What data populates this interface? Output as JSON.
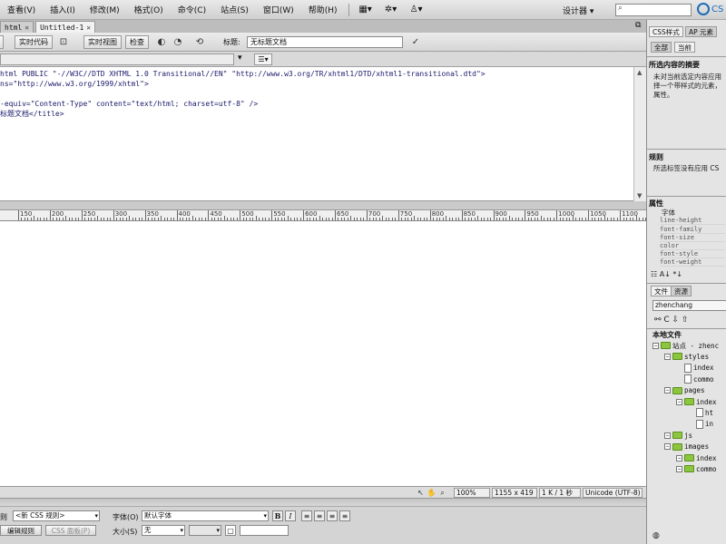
{
  "menubar": {
    "items": [
      "查看(V)",
      "插入(I)",
      "修改(M)",
      "格式(O)",
      "命令(C)",
      "站点(S)",
      "窗口(W)",
      "帮助(H)"
    ],
    "workspace": "设计器 ▾",
    "logo": "CS"
  },
  "doctabs": [
    {
      "label": "html",
      "active": false
    },
    {
      "label": "Untitled-1",
      "active": true
    }
  ],
  "doctoolbar": {
    "live_code": "实时代码",
    "live_view": "实时视图",
    "inspect": "检查",
    "title_label": "标题:",
    "title_value": "无标题文档"
  },
  "code_lines": [
    "html PUBLIC \"-//W3C//DTD XHTML 1.0 Transitional//EN\" \"http://www.w3.org/TR/xhtml1/DTD/xhtml1-transitional.dtd\">",
    "ns=\"http://www.w3.org/1999/xhtml\">",
    "",
    "-equiv=\"Content-Type\" content=\"text/html; charset=utf-8\" />",
    "标题文档</title>"
  ],
  "ruler_labels": [
    "150",
    "200",
    "250",
    "300",
    "350",
    "400",
    "450",
    "500",
    "550",
    "600",
    "650",
    "700",
    "750",
    "800",
    "850",
    "900",
    "950",
    "1000",
    "1050",
    "1100"
  ],
  "statusbar": {
    "zoom": "100%",
    "size": "1155 x 419",
    "filesize": "1 K / 1 秒",
    "encoding": "Unicode (UTF-8)"
  },
  "props": {
    "rule_label": "则",
    "rule_value": "<新 CSS 规则>",
    "edit_rule": "编辑规则",
    "css_panel": "CSS 面板(P)",
    "font_label": "字体(O)",
    "font_value": "默认字体",
    "size_label": "大小(S)",
    "size_value": "无",
    "bold": "B",
    "italic": "I"
  },
  "rpanel": {
    "tab_css": "CSS样式",
    "tab_ap": "AP 元素",
    "sub_all": "全部",
    "sub_current": "当前",
    "summary_header": "所选内容的摘要",
    "summary_lines": [
      "未对当前选定内容应用",
      "择一个带样式的元素，",
      "属性。"
    ],
    "rules_header": "规则",
    "rules_text": "所选标签没有应用 CS",
    "props_header": "属性",
    "props_group": "字体",
    "props_rows": [
      "line-height",
      "font-family",
      "font-size",
      "color",
      "font-style",
      "font-weight"
    ],
    "files_tab": "文件",
    "assets_tab": "资源",
    "site_select": "zhenchang",
    "local_files": "本地文件",
    "tree": [
      {
        "label": "站点 - zhenc",
        "indent": 0,
        "type": "folder"
      },
      {
        "label": "styles",
        "indent": 1,
        "type": "folder"
      },
      {
        "label": "index",
        "indent": 2,
        "type": "file"
      },
      {
        "label": "commo",
        "indent": 2,
        "type": "file"
      },
      {
        "label": "pages",
        "indent": 1,
        "type": "folder"
      },
      {
        "label": "index",
        "indent": 2,
        "type": "folder"
      },
      {
        "label": "ht",
        "indent": 3,
        "type": "file"
      },
      {
        "label": "in",
        "indent": 3,
        "type": "file"
      },
      {
        "label": "js",
        "indent": 1,
        "type": "folder"
      },
      {
        "label": "images",
        "indent": 1,
        "type": "folder"
      },
      {
        "label": "index",
        "indent": 2,
        "type": "folder"
      },
      {
        "label": "commo",
        "indent": 2,
        "type": "folder"
      }
    ]
  }
}
